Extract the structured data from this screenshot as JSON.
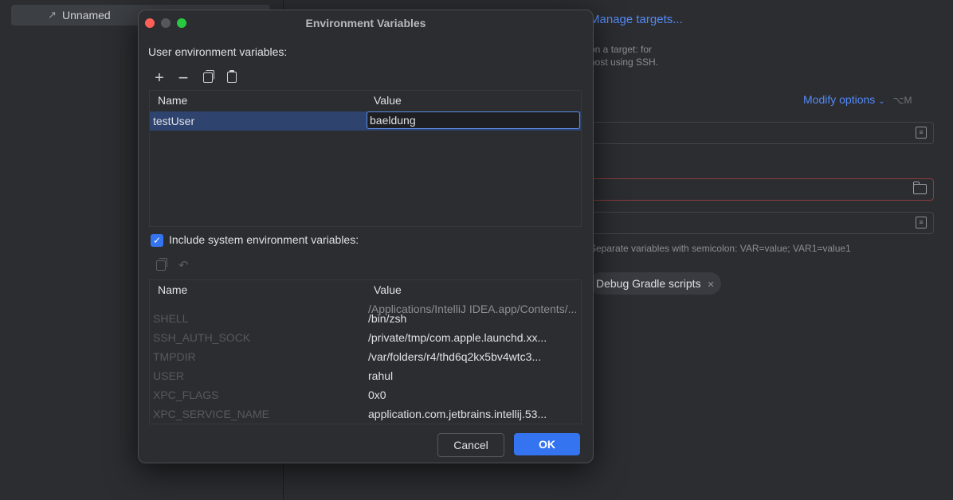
{
  "background": {
    "config_item_label": "Unnamed",
    "targets_link": "Manage targets...",
    "targets_hint_line1": "on a target: for",
    "targets_hint_line2": "host using SSH.",
    "modify_options": "Modify options",
    "modify_shortcut": "⌥M",
    "env_hint": "Separate variables with semicolon: VAR=value; VAR1=value1",
    "chip_label": "Debug Gradle scripts"
  },
  "dialog": {
    "title": "Environment Variables",
    "user_section_label": "User environment variables:",
    "user_table": {
      "columns": [
        "Name",
        "Value"
      ],
      "rows": [
        {
          "name": "testUser",
          "value": "baeldung"
        }
      ]
    },
    "include_system_label": "Include system environment variables:",
    "include_system_checked": true,
    "system_table": {
      "columns": [
        "Name",
        "Value"
      ],
      "partial_top_value": "/Applications/IntelliJ IDEA.app/Contents/...",
      "rows": [
        {
          "name": "SHELL",
          "value": "/bin/zsh"
        },
        {
          "name": "SSH_AUTH_SOCK",
          "value": "/private/tmp/com.apple.launchd.xx..."
        },
        {
          "name": "TMPDIR",
          "value": "/var/folders/r4/thd6q2kx5bv4wtc3..."
        },
        {
          "name": "USER",
          "value": "rahul"
        },
        {
          "name": "XPC_FLAGS",
          "value": "0x0"
        },
        {
          "name": "XPC_SERVICE_NAME",
          "value": "application.com.jetbrains.intellij.53..."
        }
      ]
    },
    "cancel_label": "Cancel",
    "ok_label": "OK"
  },
  "colors": {
    "accent": "#3574f0",
    "link": "#548af7",
    "selection": "#2e436e",
    "close": "#ff5f57",
    "maximize": "#28c840"
  }
}
